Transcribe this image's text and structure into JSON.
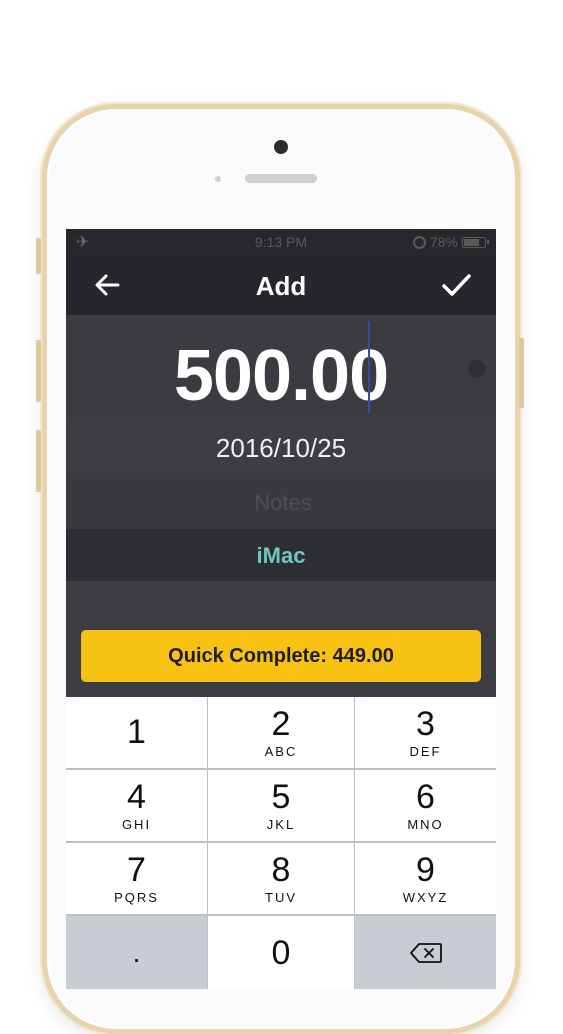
{
  "status": {
    "time": "9:13 PM",
    "battery": "78%"
  },
  "nav": {
    "title": "Add"
  },
  "entry": {
    "amount": "500.00",
    "date": "2016/10/25",
    "notes_placeholder": "Notes",
    "category": "iMac"
  },
  "quick_complete": {
    "label": "Quick Complete: 449.00"
  },
  "keypad": {
    "keys": [
      {
        "digit": "1",
        "letters": ""
      },
      {
        "digit": "2",
        "letters": "ABC"
      },
      {
        "digit": "3",
        "letters": "DEF"
      },
      {
        "digit": "4",
        "letters": "GHI"
      },
      {
        "digit": "5",
        "letters": "JKL"
      },
      {
        "digit": "6",
        "letters": "MNO"
      },
      {
        "digit": "7",
        "letters": "PQRS"
      },
      {
        "digit": "8",
        "letters": "TUV"
      },
      {
        "digit": "9",
        "letters": "WXYZ"
      },
      {
        "digit": "0",
        "letters": ""
      }
    ],
    "decimal": "."
  },
  "colors": {
    "accent_yellow": "#f8c215",
    "category_teal": "#6fc8c2",
    "navbar": "#26272a",
    "screen_bg": "#3c3d42",
    "phone_gold": "#e7d3ac"
  },
  "icons": [
    "airplane-icon",
    "alarm-icon",
    "battery-icon",
    "back-arrow-icon",
    "checkmark-icon",
    "backspace-icon"
  ]
}
